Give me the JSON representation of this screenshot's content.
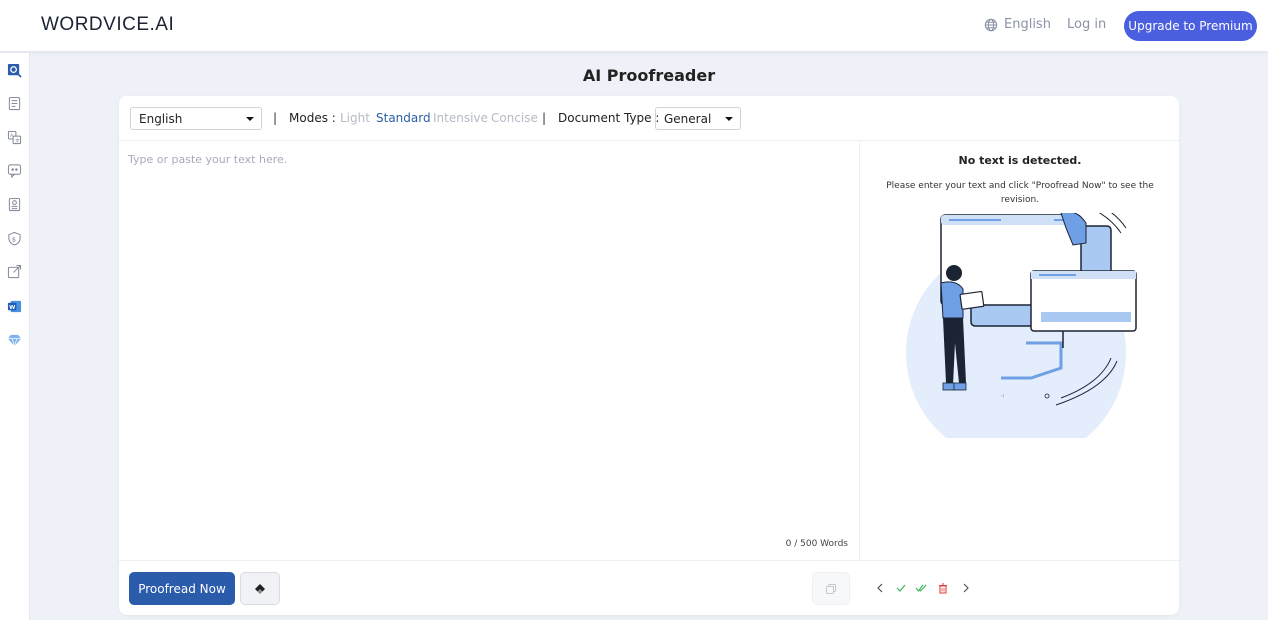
{
  "header": {
    "logo": "WORDVICE.AI",
    "language": "English",
    "login": "Log in",
    "premium": "Upgrade to Premium"
  },
  "sidebar": {
    "icons": [
      "proofreader-icon",
      "document-icon",
      "translate-icon",
      "chat-icon",
      "report-icon",
      "shield-icon",
      "external-link-icon",
      "word-icon",
      "diamond-icon"
    ]
  },
  "title": "AI Proofreader",
  "toolbar": {
    "language_value": "English",
    "sep": "|",
    "modes_label": "Modes :",
    "modes": [
      "Light",
      "Standard",
      "Intensive",
      "Concise"
    ],
    "active_mode": "Standard",
    "doc_type_label": "Document Type :",
    "doc_type_value": "General"
  },
  "editor": {
    "placeholder": "Type or paste your text here.",
    "word_count": "0 / 500 Words"
  },
  "result": {
    "title": "No text is detected.",
    "subtitle": "Please enter your text and click \"Proofread Now\" to see the revision."
  },
  "footer": {
    "proofread": "Proofread Now"
  },
  "colors": {
    "accent": "#2b5bab",
    "premium": "#4a5fe0",
    "active_mode": "#2a5ea6",
    "inactive_mode": "#b5bac6"
  }
}
